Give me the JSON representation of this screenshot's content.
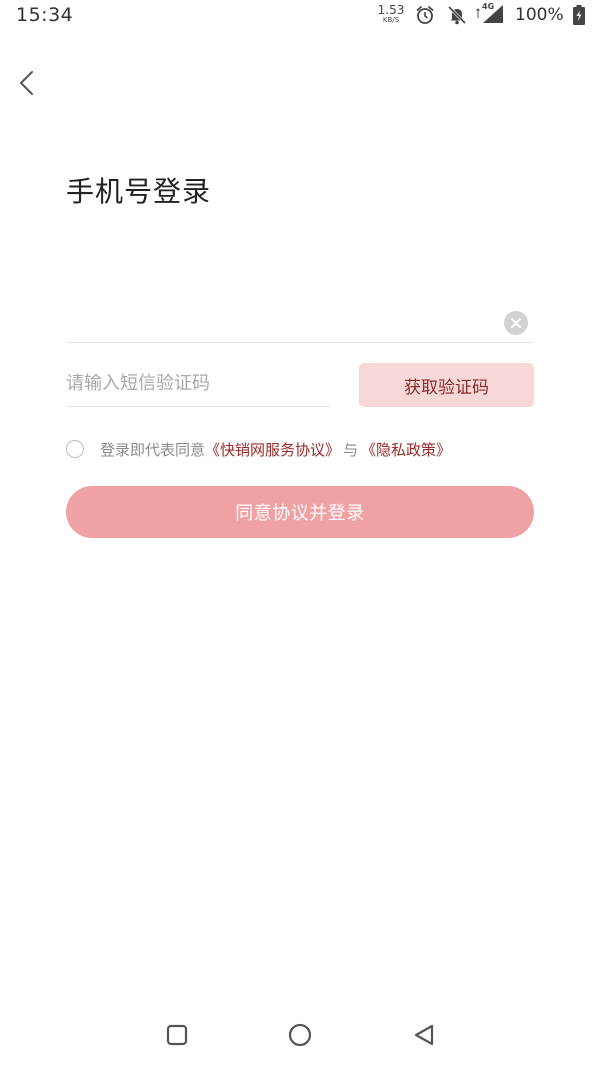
{
  "status_bar": {
    "time": "15:34",
    "net_speed_value": "1.53",
    "net_speed_unit": "KB/S",
    "network_label": "4G",
    "battery": "100%",
    "icons": [
      "alarm-icon",
      "notifications-off-icon",
      "signal-icon",
      "battery-charging-icon"
    ]
  },
  "header": {
    "back_icon": "back-arrow-icon"
  },
  "title": "手机号登录",
  "phone": {
    "value": "",
    "clear_icon": "clear-icon"
  },
  "code": {
    "placeholder": "请输入短信验证码",
    "get_code_label": "获取验证码"
  },
  "agreement": {
    "prefix": "登录即代表同意",
    "terms_link": "《快销网服务协议》",
    "conjunction": "与",
    "privacy_link": "《隐私政策》",
    "checked": false
  },
  "login_button": "同意协议并登录",
  "colors": {
    "accent": "#f0a1a3",
    "code_button_bg": "#f6d8d8",
    "link": "#9a2a2a"
  },
  "nav_bar": {
    "icons": [
      "recent-apps-icon",
      "home-icon",
      "back-icon"
    ]
  }
}
